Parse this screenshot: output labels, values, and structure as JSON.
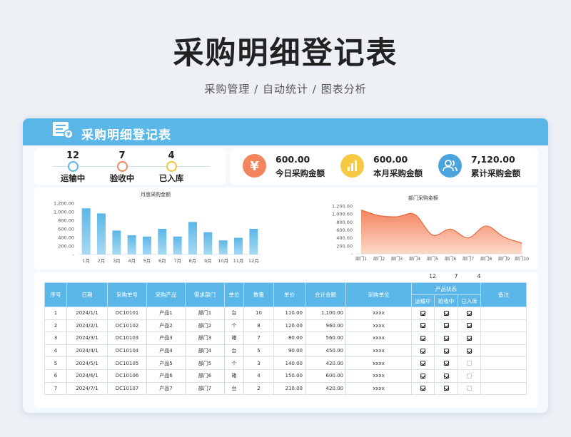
{
  "page": {
    "title": "采购明细登记表",
    "subtitle": "采购管理 / 自动统计 / 图表分析"
  },
  "card": {
    "title": "采购明细登记表"
  },
  "status": [
    {
      "value": "12",
      "label": "运输中",
      "color": "#5bb7e8"
    },
    {
      "value": "7",
      "label": "验收中",
      "color": "#f08a5d"
    },
    {
      "value": "4",
      "label": "已入库",
      "color": "#f3c53c"
    }
  ],
  "money": [
    {
      "value": "600.00",
      "label": "今日采购金额",
      "icon": "yen-icon",
      "color": "#f2845e"
    },
    {
      "value": "600.00",
      "label": "本月采购金额",
      "icon": "bar-chart-icon",
      "color": "#f6c945"
    },
    {
      "value": "7,120.00",
      "label": "累计采购金额",
      "icon": "users-icon",
      "color": "#4aa4dd"
    }
  ],
  "chart_data": [
    {
      "type": "bar",
      "title": "月度采购金额",
      "categories": [
        "1月",
        "2月",
        "3月",
        "4月",
        "5月",
        "6月",
        "7月",
        "8月",
        "9月",
        "10月",
        "11月",
        "12月"
      ],
      "values": [
        1080,
        960,
        560,
        450,
        420,
        600,
        420,
        760,
        520,
        330,
        390,
        600
      ],
      "ylim": [
        0,
        1200
      ],
      "yticks": [
        "1,200.00",
        "1,000.00",
        "800.00",
        "600.00",
        "400.00",
        "200.00",
        "-"
      ],
      "color": "#5bb7e8"
    },
    {
      "type": "area",
      "title": "部门采购金额",
      "categories": [
        "部门1",
        "部门2",
        "部门3",
        "部门4",
        "部门5",
        "部门6",
        "部门7",
        "部门8",
        "部门9",
        "部门10"
      ],
      "values": [
        1100,
        960,
        930,
        990,
        470,
        620,
        400,
        700,
        420,
        270
      ],
      "ylim": [
        0,
        1200
      ],
      "yticks": [
        "1,200.00",
        "1,000.00",
        "800.00",
        "600.00",
        "400.00",
        "200.00",
        "-"
      ],
      "color": "#f2845e"
    }
  ],
  "table": {
    "status_counts": [
      "12",
      "7",
      "4"
    ],
    "headers": [
      "序号",
      "日期",
      "采购单号",
      "采购产品",
      "需求部门",
      "单位",
      "数量",
      "单价",
      "合计金额",
      "采购单位",
      "产品状态",
      "备注"
    ],
    "sub_headers": [
      "运输中",
      "验收中",
      "已入库"
    ],
    "rows": [
      {
        "no": "1",
        "date": "2024/1/1",
        "order": "DC10101",
        "product": "产品1",
        "dept": "部门1",
        "unit": "台",
        "qty": "10",
        "price": "110.00",
        "total": "1,100.00",
        "supplier": "xxxx",
        "s1": true,
        "s2": true,
        "s3": true
      },
      {
        "no": "2",
        "date": "2024/2/1",
        "order": "DC10102",
        "product": "产品2",
        "dept": "部门2",
        "unit": "个",
        "qty": "8",
        "price": "120.00",
        "total": "960.00",
        "supplier": "xxxx",
        "s1": true,
        "s2": true,
        "s3": true
      },
      {
        "no": "3",
        "date": "2024/3/1",
        "order": "DC10103",
        "product": "产品3",
        "dept": "部门3",
        "unit": "箱",
        "qty": "7",
        "price": "80.00",
        "total": "560.00",
        "supplier": "xxxx",
        "s1": true,
        "s2": true,
        "s3": true
      },
      {
        "no": "4",
        "date": "2024/4/1",
        "order": "DC10104",
        "product": "产品4",
        "dept": "部门4",
        "unit": "台",
        "qty": "5",
        "price": "90.00",
        "total": "450.00",
        "supplier": "xxxx",
        "s1": true,
        "s2": true,
        "s3": true
      },
      {
        "no": "5",
        "date": "2024/5/1",
        "order": "DC10105",
        "product": "产品5",
        "dept": "部门5",
        "unit": "个",
        "qty": "3",
        "price": "140.00",
        "total": "420.00",
        "supplier": "xxxx",
        "s1": true,
        "s2": true,
        "s3": false
      },
      {
        "no": "6",
        "date": "2024/6/1",
        "order": "DC10106",
        "product": "产品6",
        "dept": "部门6",
        "unit": "箱",
        "qty": "4",
        "price": "150.00",
        "total": "600.00",
        "supplier": "xxxx",
        "s1": true,
        "s2": true,
        "s3": false
      },
      {
        "no": "7",
        "date": "2024/7/1",
        "order": "DC10107",
        "product": "产品7",
        "dept": "部门7",
        "unit": "台",
        "qty": "2",
        "price": "210.00",
        "total": "420.00",
        "supplier": "xxxx",
        "s1": true,
        "s2": true,
        "s3": false
      }
    ]
  }
}
